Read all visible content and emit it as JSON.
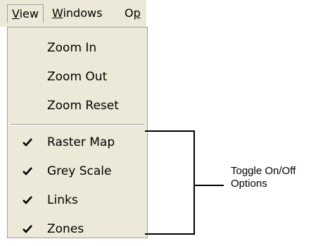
{
  "menubar": {
    "items": [
      {
        "label": "View",
        "accel": "V",
        "rest": "iew",
        "active": true
      },
      {
        "label": "Windows",
        "accel": "W",
        "rest": "indows"
      },
      {
        "label": "Op",
        "accel": "O",
        "rest": "p"
      }
    ]
  },
  "menu": {
    "items": [
      {
        "label": "Zoom In",
        "checked": false
      },
      {
        "label": "Zoom Out",
        "checked": false
      },
      {
        "label": "Zoom Reset",
        "checked": false
      },
      {
        "label": "Raster Map",
        "checked": true
      },
      {
        "label": "Grey Scale",
        "checked": true
      },
      {
        "label": "Links",
        "checked": true
      },
      {
        "label": "Zones",
        "checked": true
      }
    ]
  },
  "annotation": {
    "line1": "Toggle On/Off",
    "line2": "Options"
  },
  "icons": {
    "check": "check-icon"
  }
}
